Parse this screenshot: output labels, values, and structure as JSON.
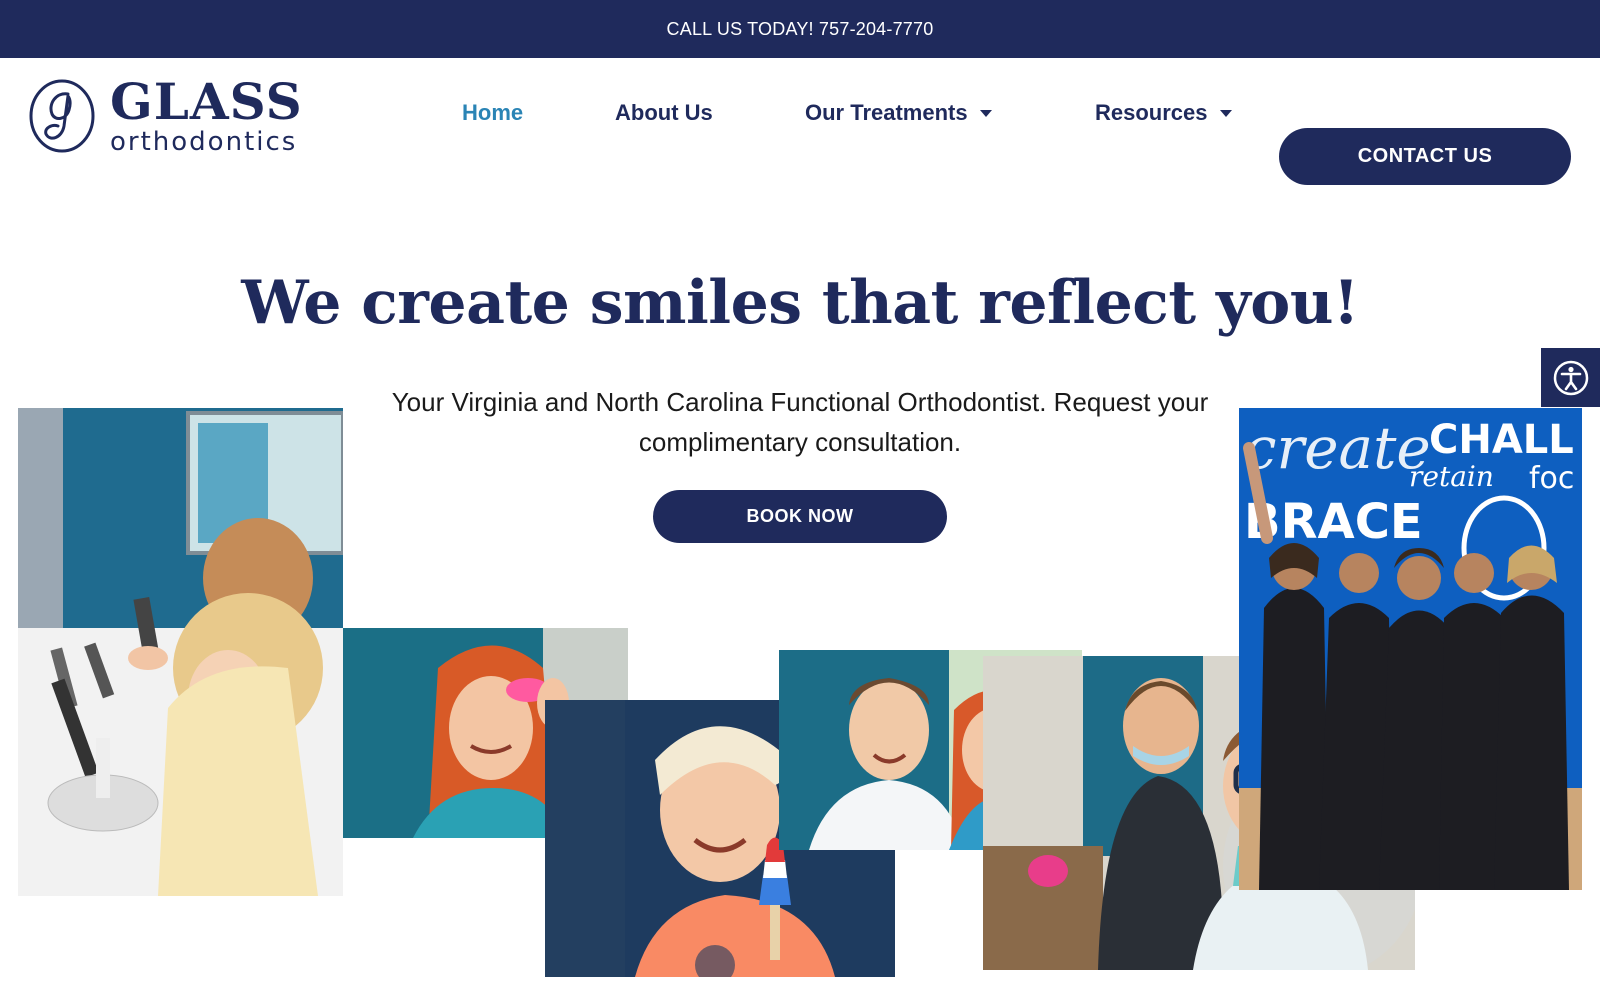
{
  "topbar": {
    "text": "CALL US TODAY! 757-204-7770"
  },
  "logo": {
    "word": "GLASS",
    "sub": "orthodontics"
  },
  "nav": {
    "items": [
      {
        "label": "Home"
      },
      {
        "label": "About Us"
      },
      {
        "label": "Our Treatments"
      },
      {
        "label": "Resources"
      }
    ],
    "contact_label": "CONTACT US"
  },
  "hero": {
    "title": "We create smiles that reflect you!",
    "subtitle": "Your Virginia and North Carolina Functional Orthodontist. Request your complimentary consultation.",
    "cta_label": "BOOK NOW"
  },
  "colors": {
    "navy": "#1f2a5c",
    "active_link": "#2a84b5",
    "teal_wall": "#1e6a86"
  },
  "icons": {
    "accessibility": "accessibility-icon",
    "dropdown": "chevron-down-icon"
  }
}
